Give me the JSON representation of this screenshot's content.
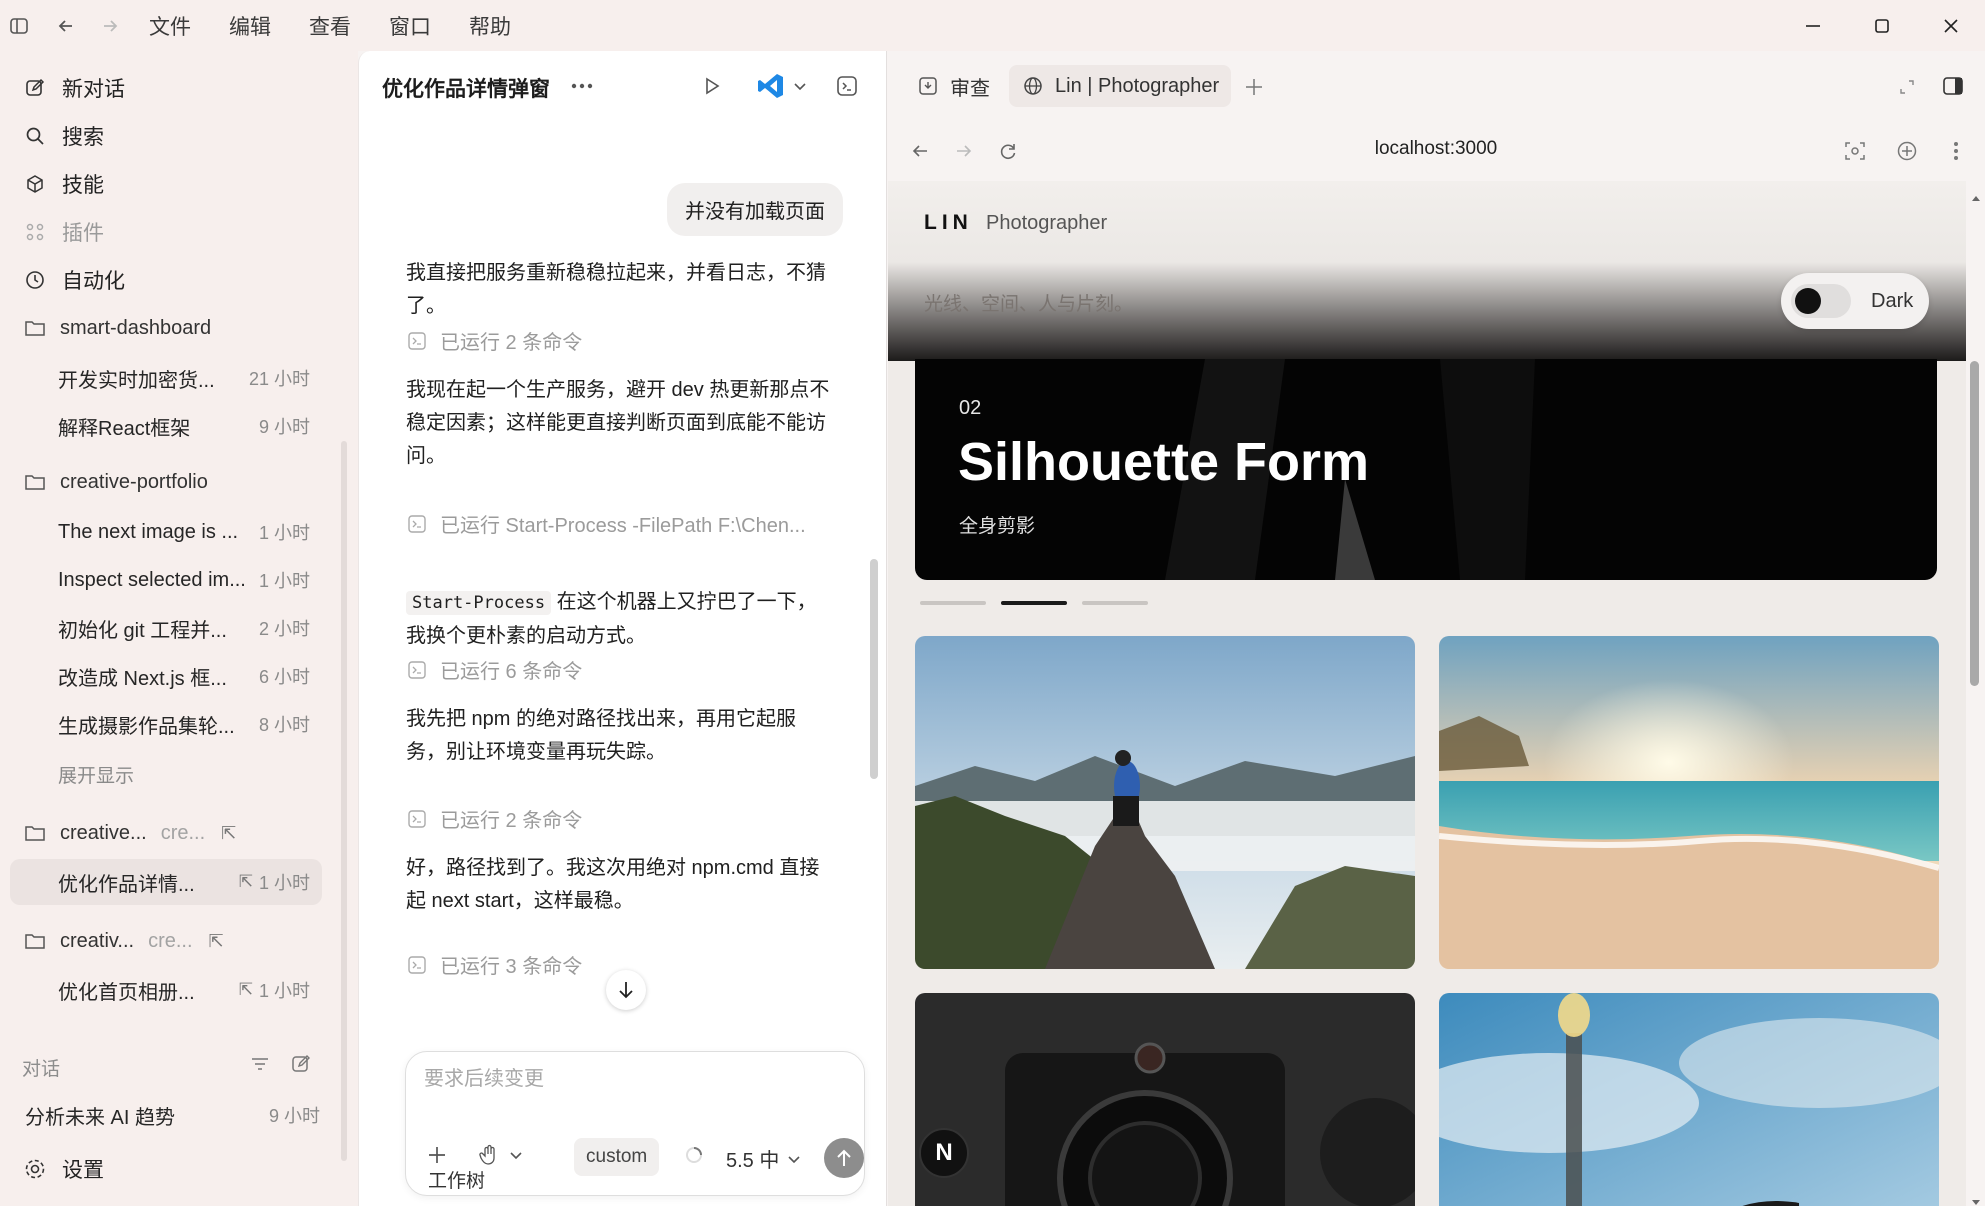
{
  "menu": {
    "items": [
      "文件",
      "编辑",
      "查看",
      "窗口",
      "帮助"
    ]
  },
  "sidebar": {
    "nav": [
      {
        "label": "新对话",
        "icon": "edit-icon",
        "disabled": false
      },
      {
        "label": "搜索",
        "icon": "search-icon",
        "disabled": false
      },
      {
        "label": "技能",
        "icon": "cube-icon",
        "disabled": false
      },
      {
        "label": "插件",
        "icon": "grid-icon",
        "disabled": true
      },
      {
        "label": "自动化",
        "icon": "clock-icon",
        "disabled": false
      }
    ],
    "projects": [
      {
        "name": "smart-dashboard",
        "sub": ""
      },
      {
        "name": "creative-portfolio",
        "sub": ""
      },
      {
        "name": "creative...",
        "sub": "cre..."
      },
      {
        "name": "creativ...",
        "sub": "cre..."
      }
    ],
    "threads": [
      {
        "title": "开发实时加密货...",
        "time": "21 小时"
      },
      {
        "title": "解释React框架",
        "time": "9 小时"
      },
      {
        "title": "The next image is ...",
        "time": "1 小时"
      },
      {
        "title": "Inspect selected im...",
        "time": "1 小时"
      },
      {
        "title": "初始化 git 工程并...",
        "time": "2 小时"
      },
      {
        "title": "改造成 Next.js 框...",
        "time": "6 小时"
      },
      {
        "title": "生成摄影作品集轮...",
        "time": "8 小时"
      },
      {
        "title": "优化作品详情...",
        "time": "1 小时"
      },
      {
        "title": "优化首页相册...",
        "time": "1 小时"
      }
    ],
    "expand_label": "展开显示",
    "chat_section_label": "对话",
    "chats": [
      {
        "title": "分析未来 AI 趋势",
        "time": "9 小时"
      }
    ],
    "settings_label": "设置"
  },
  "chat": {
    "title": "优化作品详情弹窗",
    "user_message": "并没有加载页面",
    "messages": [
      "我直接把服务重新稳稳拉起来，并看日志，不猜了。",
      "我现在起一个生产服务，避开 dev 热更新那点不稳定因素；这样能更直接判断页面到底能不能访问。",
      "在这个机器上又拧巴了一下，我换个更朴素的启动方式。",
      "我先把 npm 的绝对路径找出来，再用它起服务，别让环境变量再玩失踪。",
      "好，路径找到了。我这次用绝对 npm.cmd 直接起 next start，这样最稳。"
    ],
    "code_tokens": [
      "Start-Process",
      "npm",
      "npm.cmd",
      "next start"
    ],
    "runs": [
      "已运行 2 条命令",
      "已运行 Start-Process -FilePath F:\\Chen...",
      "已运行 6 条命令",
      "已运行 2 条命令",
      "已运行 3 条命令"
    ],
    "composer_placeholder": "要求后续变更",
    "model_chip": "custom",
    "model_version": "5.5 中",
    "worktree_label": "工作树"
  },
  "browser": {
    "tabs": [
      "审查",
      "Lin | Photographer"
    ],
    "url": "localhost:3000"
  },
  "site": {
    "brand": "LIN",
    "brand_sub": "Photographer",
    "tagline": "光线、空间、人与片刻。",
    "toggle_label": "Dark",
    "hero": {
      "number": "02",
      "title": "Silhouette Form",
      "subtitle": "全身剪影"
    },
    "carousel": {
      "count": 3,
      "active_index": 1
    },
    "badge": "N"
  },
  "colors": {
    "accent": "#111111",
    "vscode_blue": "#1e88e5",
    "sidebar_bg": "#f7efed"
  }
}
